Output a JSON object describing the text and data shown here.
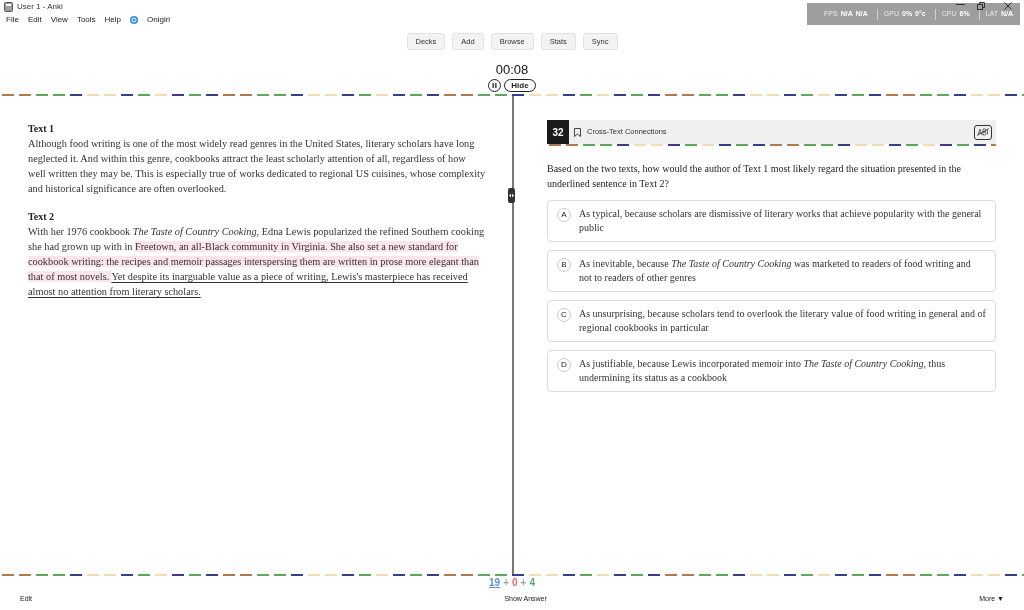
{
  "window": {
    "title": "User 1 - Anki"
  },
  "menu": [
    "File",
    "Edit",
    "View",
    "Tools",
    "Help",
    "Onigiri"
  ],
  "stats_overlay": [
    {
      "label": "FPS",
      "values": [
        "N/A",
        "N/A"
      ]
    },
    {
      "label": "GPU",
      "values": [
        "0%",
        "0°c"
      ]
    },
    {
      "label": "CPU",
      "values": [
        "6%"
      ]
    },
    {
      "label": "LAT",
      "values": [
        "N/A"
      ]
    }
  ],
  "toolbar": [
    "Decks",
    "Add",
    "Browse",
    "Stats",
    "Sync"
  ],
  "timer": {
    "time": "00:08",
    "hide_label": "Hide"
  },
  "passage": {
    "sections": [
      {
        "heading": "Text 1",
        "segments": [
          {
            "kind": "plain",
            "text": "Although food writing is one of the most widely read genres in the United States, literary scholars have long neglected it. And within this genre, cookbooks attract the least scholarly attention of all, regardless of how well written they may be. This is especially true of works dedicated to regional US cuisines, whose complexity and historical significance are often overlooked."
          }
        ]
      },
      {
        "heading": "Text 2",
        "segments": [
          {
            "kind": "plain",
            "text": "With her 1976 cookbook *The Taste of Country Cooking*, Edna Lewis popularized the refined Southern cooking she had grown up with in "
          },
          {
            "kind": "highlighted",
            "text": "Freetown, an all-Black community in Virginia. She also set a new standard for cookbook writing: the recipes and memoir passages interspersing them are written in prose more elegant than that of most novels. "
          },
          {
            "kind": "underlined",
            "text": "Yet despite its inarguable value as a piece of writing, Lewis's masterpiece has received almost no attention from literary scholars."
          }
        ]
      }
    ]
  },
  "question": {
    "number": "32",
    "bookmarked": false,
    "category": "Cross-Text Connections",
    "prompt": "Based on the two texts, how would the author of Text 1 most likely regard the situation presented in the underlined sentence in Text 2?",
    "choices": [
      {
        "letter": "A",
        "text": "As typical, because scholars are dismissive of literary works that achieve popularity with the general public",
        "selected": false
      },
      {
        "letter": "B",
        "text": "As inevitable, because *The Taste of Country Cooking* was marketed to readers of food writing and not to readers of other genres",
        "selected": false
      },
      {
        "letter": "C",
        "text": "As unsurprising, because scholars tend to overlook the literary value of food writing in general and of regional cookbooks in particular",
        "selected": false
      },
      {
        "letter": "D",
        "text": "As justifiable, because Lewis incorporated memoir into *The Taste of Country Cooking*, thus undermining its status as a cookbook",
        "selected": false
      }
    ]
  },
  "counts": [
    {
      "text": "19",
      "color": "#5b8fd6"
    },
    {
      "text": "+",
      "color": "#9ca3af"
    },
    {
      "text": "0",
      "color": "#e06c6c"
    },
    {
      "text": "+",
      "color": "#9ca3af"
    },
    {
      "text": "4",
      "color": "#4caf6a"
    }
  ],
  "bottom_bar": {
    "edit": "Edit",
    "show_answer": "Show Answer",
    "more": "More ▼"
  }
}
